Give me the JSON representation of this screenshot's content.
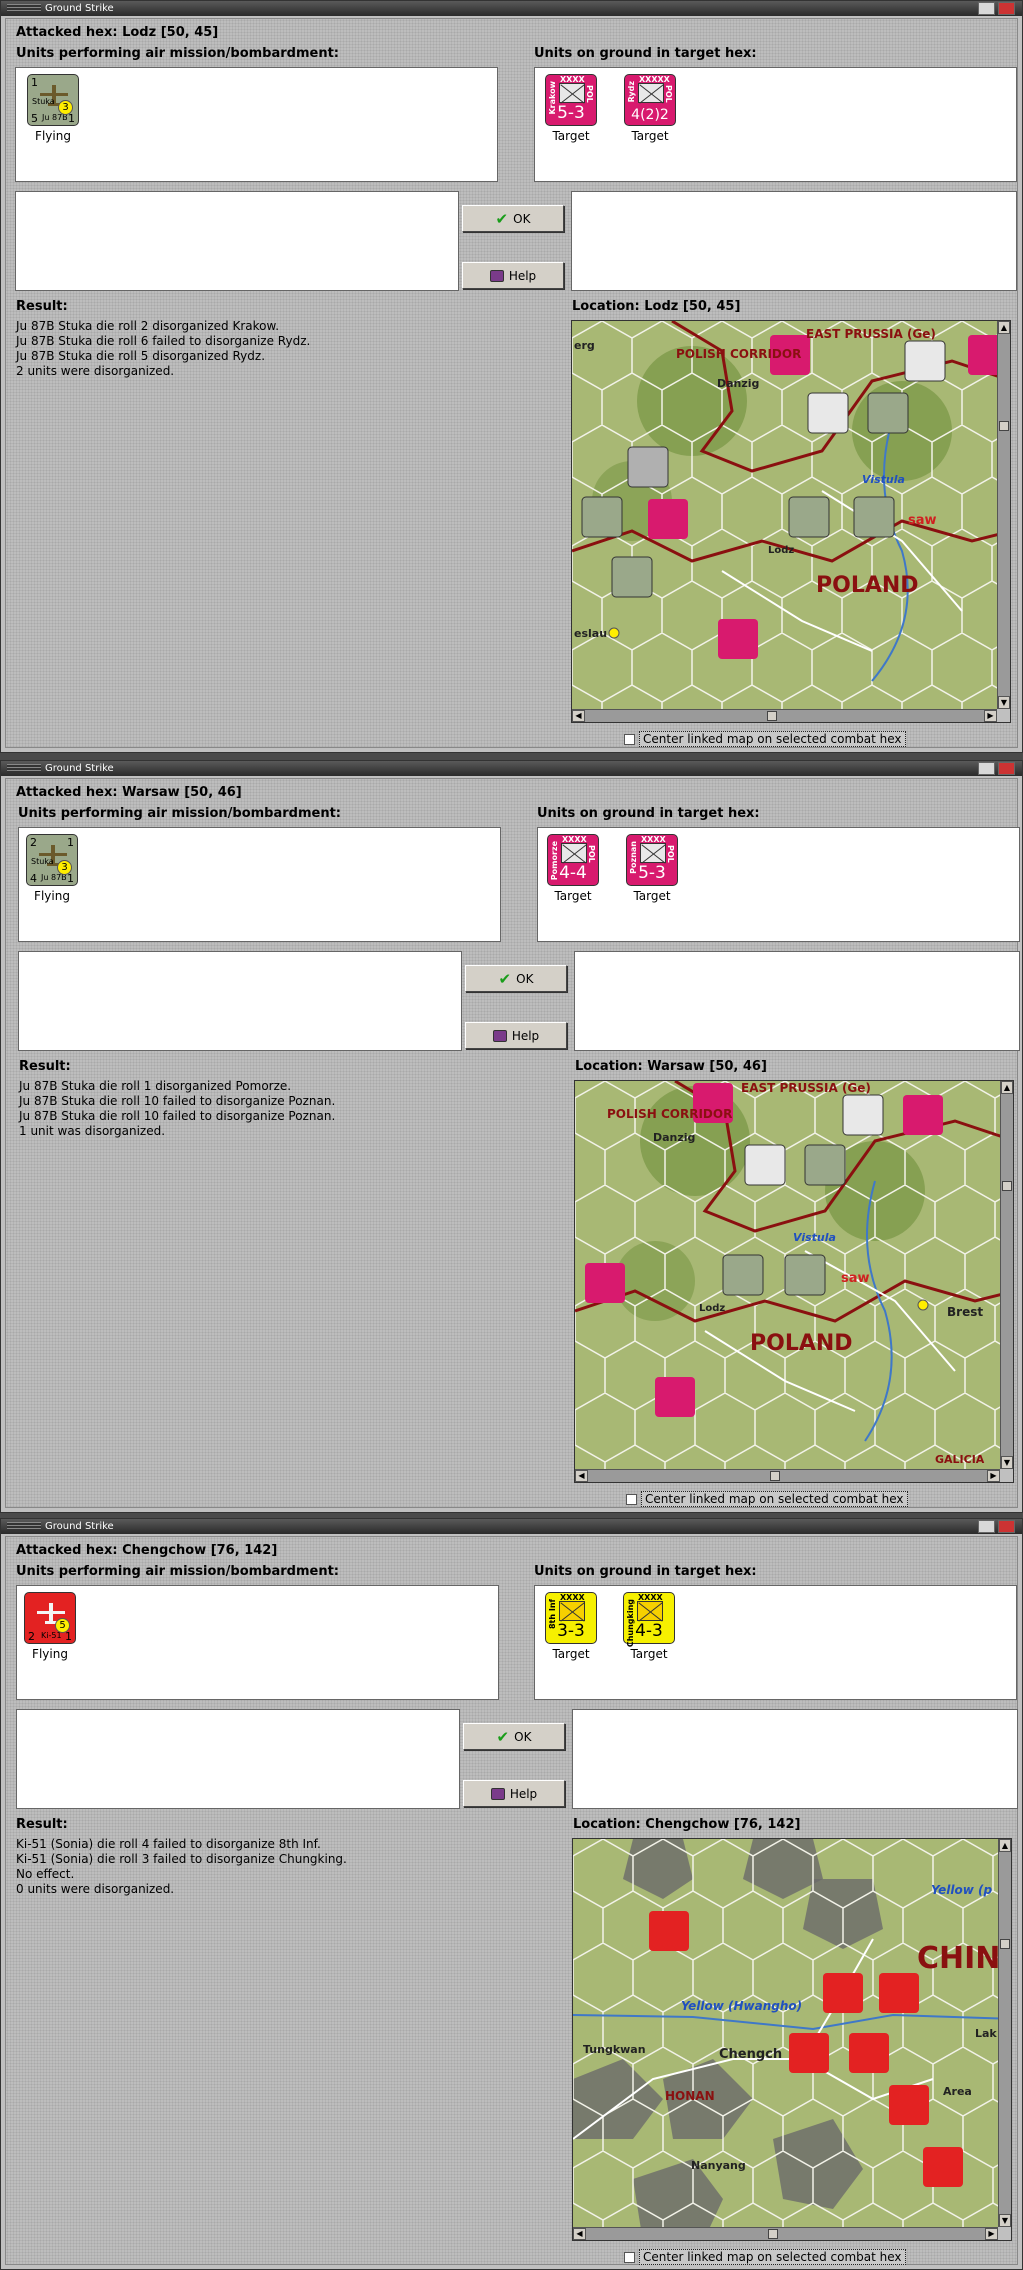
{
  "windows": [
    {
      "title": "Ground Strike",
      "attacked_hex": "Attacked hex: Lodz  [50, 45]",
      "air_label": "Units performing air mission/bombardment:",
      "ground_label": "Units on ground in target hex:",
      "air_units": [
        {
          "top_left": "1",
          "top_right": "",
          "name": "Stuka",
          "type": "Ju 87B",
          "bottom_left": "5",
          "bottom_right": "1",
          "circle": "3",
          "status": "Flying"
        }
      ],
      "ground_units": [
        {
          "side_name": "Krakow",
          "size": "XXXX",
          "nation": "POL",
          "strength": "5-3",
          "caption": "Target"
        },
        {
          "side_name": "Rydz",
          "size": "XXXXX",
          "nation": "POL",
          "strength": "4(2)2",
          "caption": "Target"
        }
      ],
      "ok_label": "OK",
      "help_label": "Help",
      "result_label": "Result:",
      "result_lines": [
        "Ju 87B Stuka die roll 2 disorganized Krakow.",
        "Ju 87B Stuka die roll 6 failed to disorganize Rydz.",
        "Ju 87B Stuka die roll 5 disorganized Rydz.",
        "2 units were disorganized."
      ],
      "location": "Location:  Lodz  [50, 45]",
      "map_labels": {
        "label_a": "POLISH CORRIDOR",
        "label_b": "EAST PRUSSIA (Ge)",
        "label_c": "Danzig",
        "label_d": "Vistula",
        "label_e": "saw",
        "label_f": "POLAND",
        "label_g": "Lodz",
        "label_h": "eslau",
        "label_i": "erg"
      },
      "center_label": "Center linked map on selected combat hex"
    },
    {
      "title": "Ground Strike",
      "attacked_hex": "Attacked hex: Warsaw  [50, 46]",
      "air_label": "Units performing air mission/bombardment:",
      "ground_label": "Units on ground in target hex:",
      "air_units": [
        {
          "top_left": "2",
          "top_right": "1",
          "name": "Stuka",
          "type": "Ju 87B",
          "bottom_left": "4",
          "bottom_right": "1",
          "circle": "3",
          "status": "Flying"
        }
      ],
      "ground_units": [
        {
          "side_name": "Pomorze",
          "size": "XXXX",
          "nation": "POL",
          "strength": "4-4",
          "caption": "Target"
        },
        {
          "side_name": "Poznan",
          "size": "XXXX",
          "nation": "POL",
          "strength": "5-3",
          "caption": "Target"
        }
      ],
      "ok_label": "OK",
      "help_label": "Help",
      "result_label": "Result:",
      "result_lines": [
        "Ju 87B Stuka die roll 1 disorganized Pomorze.",
        "Ju 87B Stuka die roll 10 failed to disorganize Poznan.",
        "Ju 87B Stuka die roll 10 failed to disorganize Poznan.",
        "1 unit was disorganized."
      ],
      "location": "Location:  Warsaw  [50, 46]",
      "map_labels": {
        "label_a": "POLISH CORRIDOR",
        "label_b": "EAST PRUSSIA (Ge)",
        "label_c": "Danzig",
        "label_d": "Vistula",
        "label_e": "saw",
        "label_f": "POLAND",
        "label_g": "Lodz",
        "label_h": "Brest",
        "label_i": "GALICIA"
      },
      "center_label": "Center linked map on selected combat hex"
    },
    {
      "title": "Ground Strike",
      "attacked_hex": "Attacked hex: Chengchow  [76, 142]",
      "air_label": "Units performing air mission/bombardment:",
      "ground_label": "Units on ground in target hex:",
      "air_units": [
        {
          "top_left": "",
          "top_right": "",
          "name": "",
          "type": "Ki-51",
          "bottom_left": "2",
          "bottom_right": "1",
          "circle": "5",
          "status": "Flying"
        }
      ],
      "ground_units": [
        {
          "side_name": "8th Inf",
          "size": "XXXX",
          "nation": "",
          "strength": "3-3",
          "caption": "Target"
        },
        {
          "side_name": "Chungking",
          "size": "XXXX",
          "nation": "",
          "strength": "4-3",
          "caption": "Target"
        }
      ],
      "ok_label": "OK",
      "help_label": "Help",
      "result_label": "Result:",
      "result_lines": [
        "Ki-51 (Sonia) die roll 4 failed to disorganize 8th Inf.",
        "Ki-51 (Sonia) die roll 3 failed to disorganize Chungking.",
        "No effect.",
        "0 units were disorganized."
      ],
      "location": "Location:  Chengchow  [76, 142]",
      "map_labels": {
        "label_a": "Yellow (Hwangho)",
        "label_b": "Yellow (p",
        "label_c": "CHIN",
        "label_d": "Tungkwan",
        "label_e": "Chengch",
        "label_f": "HONAN",
        "label_g": "Nanyang",
        "label_h": "Area",
        "label_i": "Lak"
      },
      "center_label": "Center linked map on selected combat hex"
    }
  ],
  "icons": {
    "ok": "check-icon",
    "help": "book-icon",
    "air": "aircraft-icon",
    "ground": "infantry-icon"
  }
}
